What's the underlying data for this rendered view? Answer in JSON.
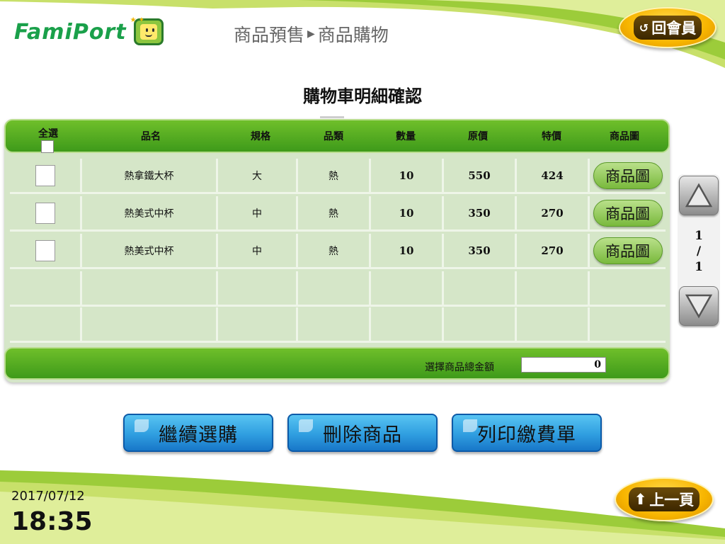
{
  "header": {
    "logo_text": "FamiPort",
    "breadcrumb_section": "商品預售",
    "breadcrumb_page": "商品購物",
    "member_button_label": "回會員",
    "member_icon": "return-arrow-icon"
  },
  "page_title": "購物車明細確認",
  "table": {
    "columns": {
      "select_all": "全選",
      "name": "品名",
      "spec": "規格",
      "category": "品類",
      "quantity": "數量",
      "original_price": "原價",
      "special_price": "特價",
      "image": "商品圖"
    },
    "rows": [
      {
        "name": "熱拿鐵大杯",
        "spec": "大",
        "category": "熱",
        "quantity": "10",
        "original_price": "550",
        "special_price": "424",
        "image_button": "商品圖"
      },
      {
        "name": "熱美式中杯",
        "spec": "中",
        "category": "熱",
        "quantity": "10",
        "original_price": "350",
        "special_price": "270",
        "image_button": "商品圖"
      },
      {
        "name": "熱美式中杯",
        "spec": "中",
        "category": "熱",
        "quantity": "10",
        "original_price": "350",
        "special_price": "270",
        "image_button": "商品圖"
      }
    ],
    "total_label": "選擇商品總金額",
    "total_value": "0"
  },
  "pager": {
    "current": "1",
    "separator": "/",
    "total": "1"
  },
  "actions": {
    "continue_label": "繼續選購",
    "delete_label": "刪除商品",
    "print_label": "列印繳費單"
  },
  "footer": {
    "date": "2017/07/12",
    "time": "18:35",
    "back_label": "上一頁",
    "back_icon": "up-arrow-icon"
  },
  "colors": {
    "brand_green": "#3e9a1a",
    "panel_bg": "#d5e6c8",
    "action_blue": "#2f9ee0",
    "gold": "#f7b500"
  }
}
